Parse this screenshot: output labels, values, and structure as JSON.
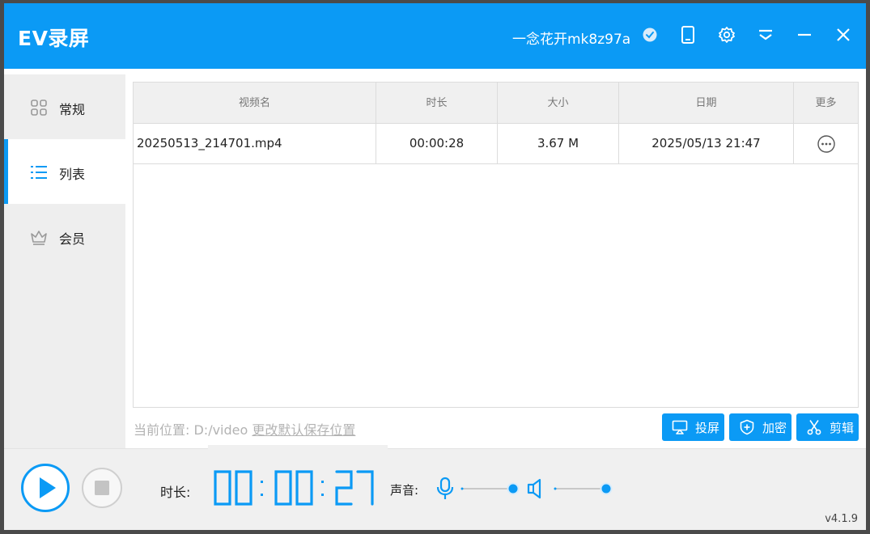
{
  "app": {
    "title": "EV录屏",
    "username": "一念花开mk8z97a",
    "version": "v4.1.9"
  },
  "sidebar": {
    "items": [
      {
        "label": "常规",
        "icon": "grid-icon",
        "active": false
      },
      {
        "label": "列表",
        "icon": "list-icon",
        "active": true
      },
      {
        "label": "会员",
        "icon": "crown-icon",
        "active": false
      }
    ]
  },
  "table": {
    "columns": [
      "视频名",
      "时长",
      "大小",
      "日期",
      "更多"
    ],
    "rows": [
      {
        "name": "20250513_214701.mp4",
        "duration": "00:00:28",
        "size": "3.67 M",
        "date": "2025/05/13 21:47"
      }
    ]
  },
  "footer": {
    "path_prefix": "当前位置: D:/video",
    "change_link": "更改默认保存位置"
  },
  "actions": {
    "cast": "投屏",
    "encrypt": "加密",
    "edit": "剪辑"
  },
  "recorder": {
    "duration_label": "时长:",
    "timer": "00:00:27",
    "audio_label": "声音:"
  },
  "colors": {
    "accent": "#0b9af5",
    "sidebar_bg": "#eeeeee"
  }
}
